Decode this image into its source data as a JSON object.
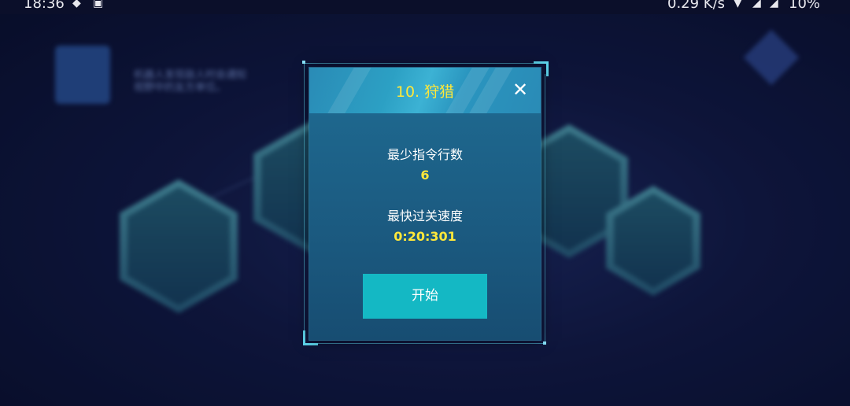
{
  "status_bar": {
    "time": "18:36",
    "speed": "0.29 K/s",
    "battery": "10%"
  },
  "background": {
    "hint_lines": [
      "机器人发现敌人时会通知",
      "视野中的友方单位。"
    ]
  },
  "dialog": {
    "title": "10. 狩猎",
    "close_symbol": "✕",
    "min_commands_label": "最少指令行数",
    "min_commands_value": "6",
    "fastest_time_label": "最快过关速度",
    "fastest_time_value": "0:20:301",
    "start_label": "开始"
  },
  "colors": {
    "accent_yellow": "#ffe83a",
    "button_cyan": "#14b8c4",
    "dialog_blue": "#1f6c93"
  }
}
